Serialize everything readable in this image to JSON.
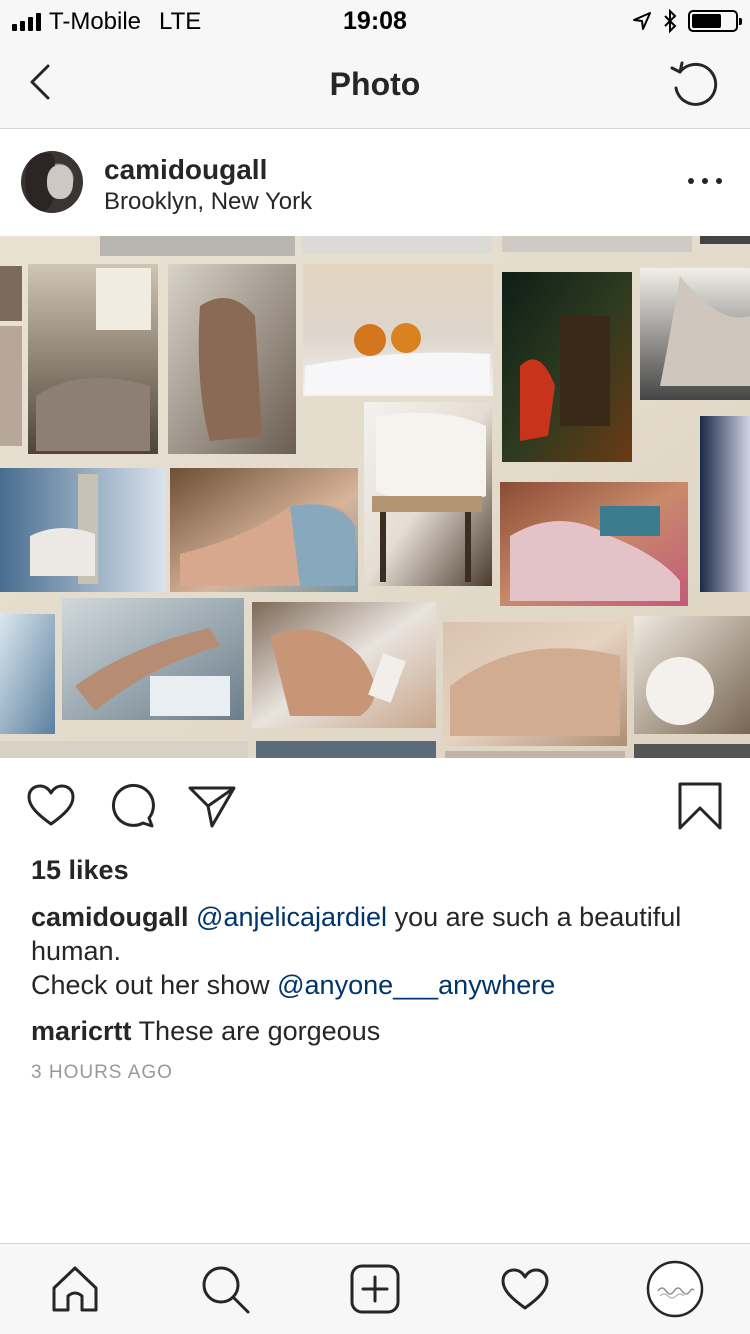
{
  "status_bar": {
    "carrier": "T-Mobile",
    "network": "LTE",
    "time": "19:08",
    "battery_level": 0.7
  },
  "nav": {
    "title": "Photo",
    "back_icon": "chevron-left-icon",
    "refresh_icon": "refresh-icon"
  },
  "post": {
    "username": "camidougall",
    "location": "Brooklyn, New York",
    "more_icon": "more-horizontal-icon",
    "image_description_icon": "photo-collage",
    "likes": "15 likes",
    "caption": {
      "author": "camidougall",
      "mention1": "@anjelicajardiel",
      "text1": " you are such a beautiful human.",
      "line2_text": "Check out her show ",
      "mention2": "@anyone___anywhere"
    },
    "comments": [
      {
        "author": "maricrtt",
        "text": "These are gorgeous"
      }
    ],
    "timestamp": "3 HOURS AGO"
  },
  "actions": {
    "like_icon": "heart-icon",
    "comment_icon": "comment-icon",
    "share_icon": "send-icon",
    "save_icon": "bookmark-icon"
  },
  "tab_bar": {
    "items": [
      "home-icon",
      "search-icon",
      "add-post-icon",
      "activity-icon",
      "profile-icon"
    ]
  },
  "colors": {
    "text": "#262626",
    "mention": "#003569",
    "muted": "#999999",
    "bar_background": "#f7f7f7"
  }
}
